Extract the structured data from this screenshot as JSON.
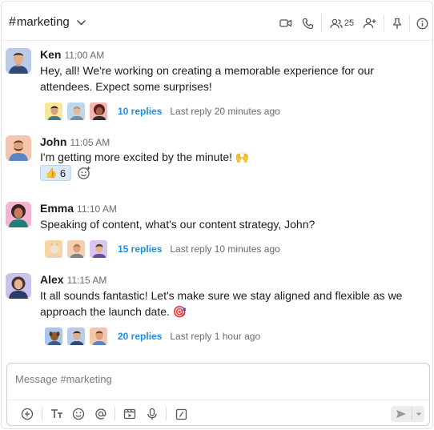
{
  "channel": {
    "hash": "#",
    "name": "marketing"
  },
  "header": {
    "icons": [
      "video-icon",
      "phone-icon",
      "members-icon",
      "add-member-icon",
      "pin-icon",
      "info-icon"
    ],
    "member_count": "25"
  },
  "messages": [
    {
      "author": "Ken",
      "time": "11:00 AM",
      "text": "Hey, all! We're working on creating a memorable experience for our attendees. Expect some surprises!",
      "thread": {
        "count_label": "10 replies",
        "last_reply": "Last reply 20 minutes ago"
      }
    },
    {
      "author": "John",
      "time": "11:05 AM",
      "text": "I'm getting more excited by the minute! 🙌",
      "reaction": {
        "emoji": "👍",
        "count": "6"
      }
    },
    {
      "author": "Emma",
      "time": "11:10 AM",
      "text": "Speaking of content, what's our content strategy, John?",
      "thread": {
        "count_label": "15 replies",
        "last_reply": "Last reply 10 minutes ago"
      }
    },
    {
      "author": "Alex",
      "time": "11:15 AM",
      "text": "It all sounds fantastic! Let's make sure we stay aligned and flexible as we approach the launch date. 🎯",
      "thread": {
        "count_label": "20 replies",
        "last_reply": "Last reply 1 hour ago"
      }
    }
  ],
  "composer": {
    "placeholder": "Message #marketing",
    "value": "",
    "tools": [
      "add-icon",
      "text-format-icon",
      "emoji-icon",
      "mention-icon",
      "video-clip-icon",
      "microphone-icon",
      "slash-command-icon"
    ]
  },
  "colors": {
    "link": "#1d8fe1",
    "reaction_bg": "#dbe9f7",
    "reaction_border": "#b9d5f3",
    "muted_text": "#6b6b6b"
  }
}
